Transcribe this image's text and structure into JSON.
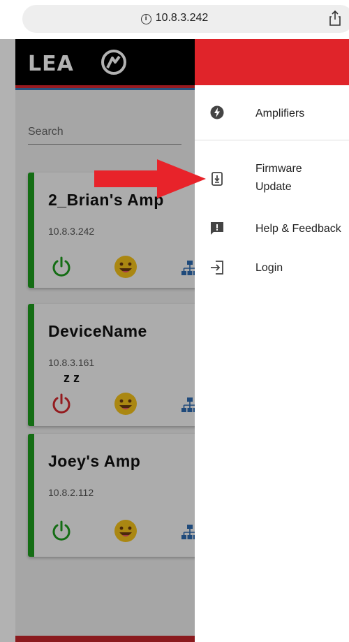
{
  "browser": {
    "url": "10.8.3.242"
  },
  "app": {
    "logo_text": "LEA",
    "search_label": "Search",
    "devices": [
      {
        "name": "2_Brian's Amp",
        "ip": "10.8.3.242",
        "status": "on"
      },
      {
        "name": "DeviceName",
        "ip": "10.8.3.161",
        "status": "sleep",
        "sleep_text": "z z"
      },
      {
        "name": "Joey's Amp",
        "ip": "10.8.2.112",
        "status": "on"
      }
    ]
  },
  "drawer": {
    "items": [
      {
        "label": "Amplifiers",
        "icon": "bolt-icon"
      },
      {
        "label": "Firmware",
        "label2": "Update",
        "icon": "firmware-download-icon"
      },
      {
        "label": "Help & Feedback",
        "icon": "feedback-icon"
      },
      {
        "label": "Login",
        "icon": "login-icon"
      }
    ]
  },
  "colors": {
    "accent_red": "#e0242a",
    "online_green": "#1e9c1e",
    "blue_stripe": "#3a77b8",
    "arrow_red": "#e8232a"
  }
}
